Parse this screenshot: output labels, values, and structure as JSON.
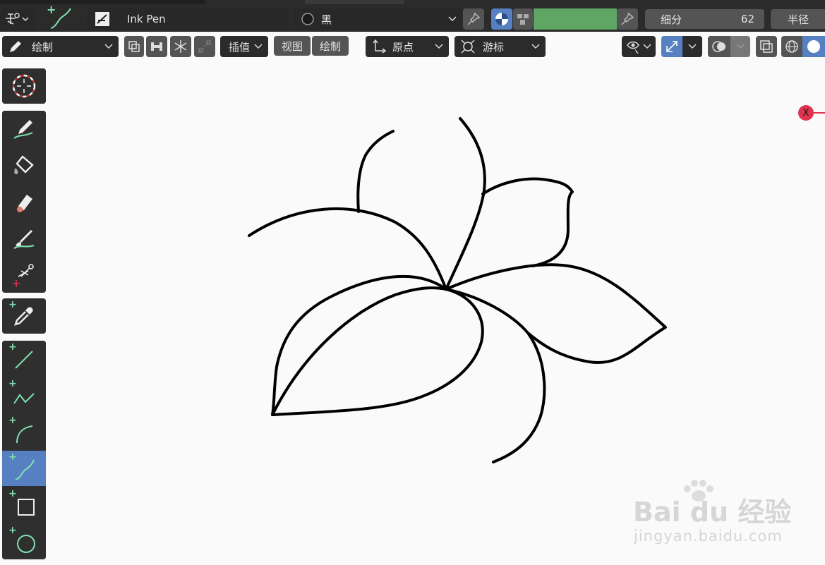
{
  "header": {
    "brush_name": "Ink Pen",
    "material_name": "黑",
    "subdivide_label": "细分",
    "subdivide_value": "62",
    "radius_label": "半径",
    "color_swatch": "#5fa564"
  },
  "toolbar": {
    "mode_label": "绘制",
    "interpolate_label": "插值",
    "view_tab": "视图",
    "draw_tab": "绘制",
    "origin_label": "原点",
    "cursor_label": "游标"
  },
  "colors": {
    "accent": "#5680c2",
    "panel": "#2f2f2f",
    "tool_plus": "#7fe0b0",
    "x_axis": "#e0334e"
  },
  "tools": [
    {
      "name": "cursor-icon"
    },
    {
      "name": "draw-icon"
    },
    {
      "name": "fill-icon"
    },
    {
      "name": "erase-icon"
    },
    {
      "name": "tint-icon"
    },
    {
      "name": "cutter-icon"
    },
    {
      "name": "eyedropper-icon"
    },
    {
      "name": "line-icon"
    },
    {
      "name": "polyline-icon"
    },
    {
      "name": "arc-icon"
    },
    {
      "name": "curve-icon"
    },
    {
      "name": "box-icon"
    },
    {
      "name": "circle-icon"
    }
  ],
  "gizmo": {
    "x_label": "X"
  },
  "watermark": {
    "brand": "Bai du 经验",
    "url": "jingyan.baidu.com"
  }
}
